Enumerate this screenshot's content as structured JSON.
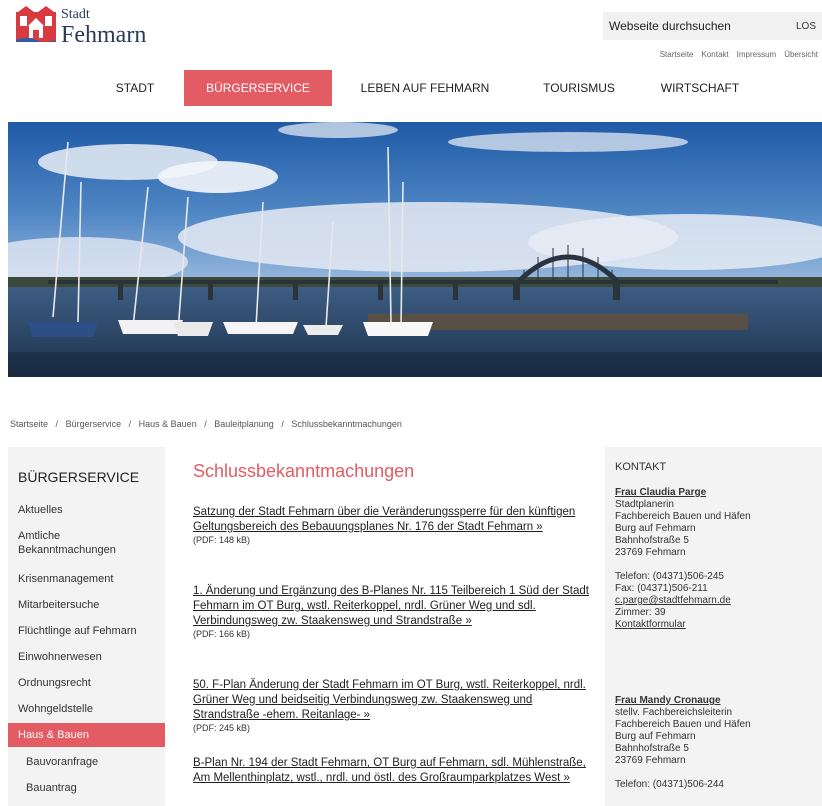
{
  "header": {
    "logo_small": "Stadt",
    "logo_big": "Fehmarn",
    "search_placeholder": "Webseite durchsuchen",
    "search_button": "LOS",
    "util_links": [
      "Startseite",
      "Kontakt",
      "Impressum",
      "Übersicht"
    ]
  },
  "nav": {
    "items": [
      "Stadt",
      "Bürgerservice",
      "Leben auf Fehmarn",
      "Tourismus",
      "Wirtschaft"
    ],
    "active_index": 1
  },
  "breadcrumb": [
    "Startseite",
    "/",
    "Bürgerservice",
    "/",
    "Haus & Bauen",
    "/",
    "Bauleitplanung",
    "/",
    "Schlussbekanntmachungen"
  ],
  "sidebar": {
    "title": "Bürgerservice",
    "items": [
      "Aktuelles",
      "Amtliche Bekanntmachungen",
      "Krisenmanagement",
      "Mitarbeitersuche",
      "Flüchtlinge auf Fehmarn",
      "Einwohnerwesen",
      "Ordnungsrecht",
      "Wohngeldstelle",
      "Haus & Bauen"
    ],
    "active_item": "Haus & Bauen",
    "sub_items": [
      "Bauvoranfrage",
      "Bauantrag"
    ]
  },
  "main": {
    "title": "Schlussbekanntmachungen",
    "documents": [
      {
        "link": "Satzung der Stadt Fehmarn über die Veränderungssperre für den künftigen Geltungsbereich des Bebauungsplanes Nr. 176 der Stadt Fehmarn »",
        "meta": "(PDF: 148 kB)"
      },
      {
        "link": "1. Änderung und Ergänzung des B-Planes Nr. 115 Teilbereich 1 Süd der Stadt Fehmarn im OT Burg, wstl. Reiterkoppel, nrdl. Grüner Weg und sdl. Verbindungsweg zw. Staakensweg und Strandstraße »",
        "meta": "(PDF: 166 kB)"
      },
      {
        "link": "50. F-Plan Änderung der Stadt Fehmarn im OT Burg, wstl. Reiterkoppel, nrdl. Grüner Weg und beidseitig Verbindungsweg zw. Staakensweg und Strandstraße -ehem. Reitanlage- »",
        "meta": "(PDF: 245 kB)"
      },
      {
        "link": "B-Plan Nr. 194 der Stadt Fehmarn, OT Burg auf Fehmarn, sdl. Mühlenstraße, Am Mellenthinplatz, wstl., nrdl. und östl. des Großraumparkplatzes West »",
        "meta": ""
      }
    ]
  },
  "contact": {
    "title": "Kontakt",
    "persons": [
      {
        "name": "Frau Claudia Parge",
        "lines": [
          "Stadtplanerin",
          "Fachbereich Bauen und Häfen",
          "Burg auf Fehmarn",
          "Bahnhofstraße 5",
          "23769 Fehmarn"
        ],
        "phone": "Telefon:  (04371)506-245",
        "fax": "Fax:  (04371)506-211",
        "email": "c.parge@stadtfehmarn.de",
        "room": "Zimmer:  39",
        "form": "Kontaktformular"
      },
      {
        "name": "Frau Mandy Cronauge",
        "lines": [
          "stellv. Fachbereichsleiterin",
          "Fachbereich Bauen und Häfen",
          "Burg auf Fehmarn",
          "Bahnhofstraße 5",
          "23769 Fehmarn"
        ],
        "phone": "Telefon:  (04371)506-244"
      }
    ]
  },
  "colors": {
    "accent": "#e35b63",
    "sidebar_bg": "#f3f3f3",
    "search_bg": "#f1f1f1"
  },
  "icons": {
    "logo": "city-crest-icon"
  }
}
